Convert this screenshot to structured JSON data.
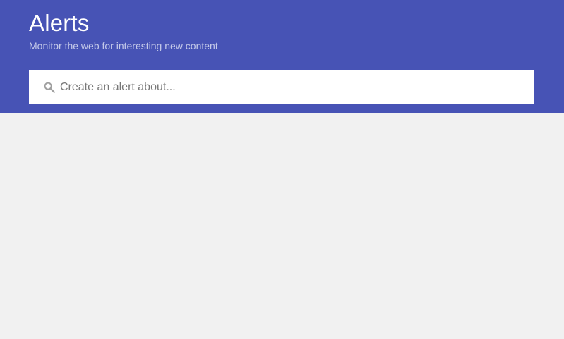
{
  "header": {
    "title": "Alerts",
    "subtitle": "Monitor the web for interesting new content",
    "background_color": "#4753b5"
  },
  "search": {
    "placeholder": "Create an alert about...",
    "value": "",
    "icon": "search-icon"
  },
  "page": {
    "background_color": "#f1f1f1"
  }
}
